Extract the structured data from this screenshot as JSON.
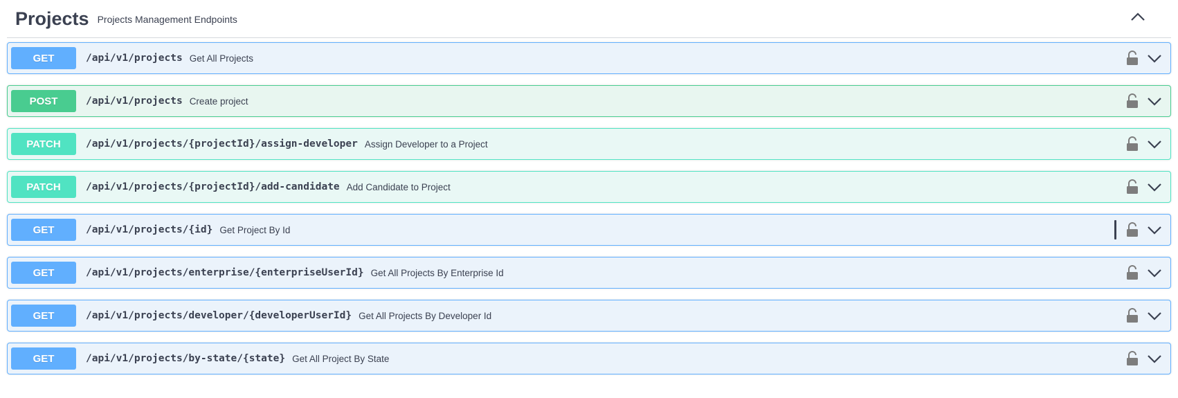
{
  "tag": {
    "title": "Projects",
    "description": "Projects Management Endpoints",
    "collapse_icon": "chevron-up-icon"
  },
  "operations": [
    {
      "method": "GET",
      "path": "/api/v1/projects",
      "summary": "Get All Projects"
    },
    {
      "method": "POST",
      "path": "/api/v1/projects",
      "summary": "Create project"
    },
    {
      "method": "PATCH",
      "path": "/api/v1/projects/{projectId}/assign-developer",
      "summary": "Assign Developer to a Project"
    },
    {
      "method": "PATCH",
      "path": "/api/v1/projects/{projectId}/add-candidate",
      "summary": "Add Candidate to Project"
    },
    {
      "method": "GET",
      "path": "/api/v1/projects/{id}",
      "summary": "Get Project By Id"
    },
    {
      "method": "GET",
      "path": "/api/v1/projects/enterprise/{enterpriseUserId}",
      "summary": "Get All Projects By Enterprise Id"
    },
    {
      "method": "GET",
      "path": "/api/v1/projects/developer/{developerUserId}",
      "summary": "Get All Projects By Developer Id"
    },
    {
      "method": "GET",
      "path": "/api/v1/projects/by-state/{state}",
      "summary": "Get All Project By State"
    }
  ],
  "colors": {
    "get": "#61affe",
    "post": "#49cc90",
    "patch": "#50e3c2",
    "text": "#3b4151"
  },
  "icons": {
    "lock": "lock-icon",
    "expand": "chevron-down-icon"
  }
}
